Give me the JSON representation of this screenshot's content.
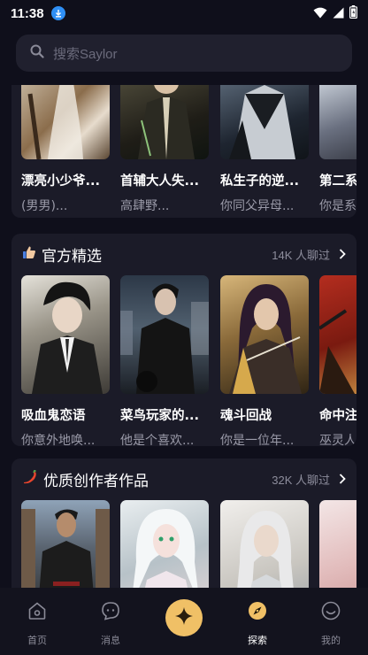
{
  "status": {
    "time": "11:38"
  },
  "search": {
    "placeholder": "搜索Saylor"
  },
  "sections": [
    {
      "cards": [
        {
          "title": "漂亮小少爷...",
          "subtitle": "(男男)..."
        },
        {
          "title": "首辅大人失...",
          "subtitle": "高肆野..."
        },
        {
          "title": "私生子的逆...",
          "subtitle": "你同父异母..."
        },
        {
          "title": "第二系",
          "subtitle": "你是系"
        }
      ]
    },
    {
      "title": "官方精选",
      "more": "14K 人聊过",
      "icon": "thumbs-up-icon",
      "cards": [
        {
          "title": "吸血鬼恋语",
          "subtitle": "你意外地唤..."
        },
        {
          "title": "菜鸟玩家的...",
          "subtitle": "他是个喜欢..."
        },
        {
          "title": "魂斗回战",
          "subtitle": "你是一位年..."
        },
        {
          "title": "命中注",
          "subtitle": "巫灵人"
        }
      ]
    },
    {
      "title": "优质创作者作品",
      "more": "32K 人聊过",
      "icon": "chili-pepper-icon",
      "cards": []
    }
  ],
  "nav": {
    "items": [
      {
        "label": "首页"
      },
      {
        "label": "消息"
      },
      {
        "label": "探索"
      },
      {
        "label": "我的"
      }
    ],
    "active": "探索"
  }
}
